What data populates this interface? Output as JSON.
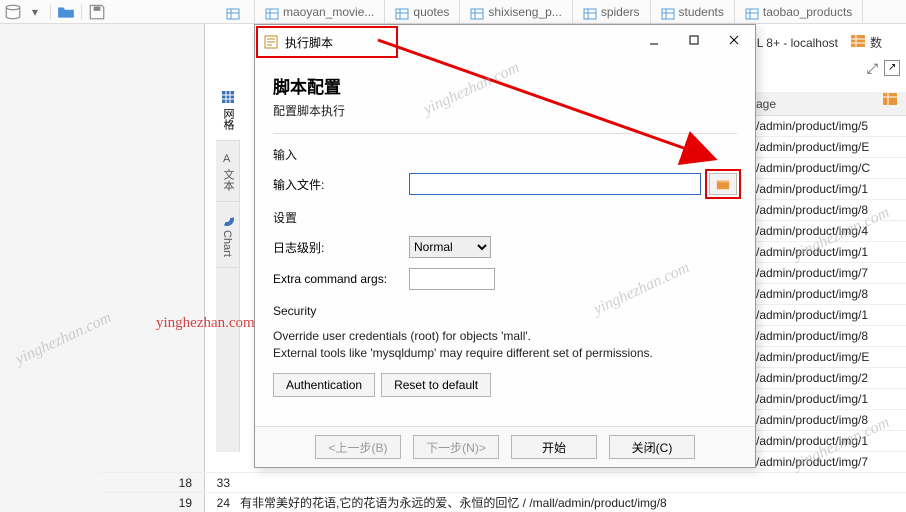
{
  "toolbar": {
    "tabs": [
      "",
      "maoyan_movie...",
      "quotes",
      "shixiseng_p...",
      "spiders",
      "students",
      "taobao_products"
    ]
  },
  "connection_label": "SQL 8+ - localhost",
  "connection_right_label": "数",
  "column_header": "age",
  "data_rows": [
    "/admin/product/img/5",
    "/admin/product/img/E",
    "/admin/product/img/C",
    "/admin/product/img/1",
    "/admin/product/img/8",
    "/admin/product/img/4",
    "/admin/product/img/1",
    "/admin/product/img/7",
    "/admin/product/img/8",
    "/admin/product/img/1",
    "/admin/product/img/8",
    "/admin/product/img/E",
    "/admin/product/img/2",
    "/admin/product/img/1",
    "/admin/product/img/8",
    "/admin/product/img/1",
    "/admin/product/img/7"
  ],
  "vtabs": {
    "t1": "网格",
    "t2": "文本",
    "t3": "Chart"
  },
  "dialog": {
    "title": "执行脚本",
    "h1": "脚本配置",
    "sub": "配置脚本执行",
    "section_input": "输入",
    "input_file_label": "输入文件:",
    "section_settings": "设置",
    "log_level_label": "日志级别:",
    "log_level_value": "Normal",
    "extra_cmd_label": "Extra command args:",
    "section_security": "Security",
    "note_line1": "Override user credentials (root) for objects 'mall'.",
    "note_line2": "External tools like 'mysqldump' may require different set of permissions.",
    "btn_auth": "Authentication",
    "btn_reset": "Reset to default",
    "wizard_prev": "<上一步(B)",
    "wizard_next": "下一步(N)>",
    "wizard_start": "开始",
    "wizard_close": "关闭(C)"
  },
  "bottom_rows": [
    {
      "idx": "",
      "n": "",
      "txt": ""
    },
    {
      "idx": "18",
      "n": "33",
      "txt": ""
    },
    {
      "idx": "19",
      "n": "24",
      "txt": "有非常美好的花语,它的花语为永远的爱、永恒的回忆 / /mall/admin/product/img/8"
    }
  ],
  "watermark": "yinghezhan.com",
  "watermark_red": "yinghezhan.com"
}
